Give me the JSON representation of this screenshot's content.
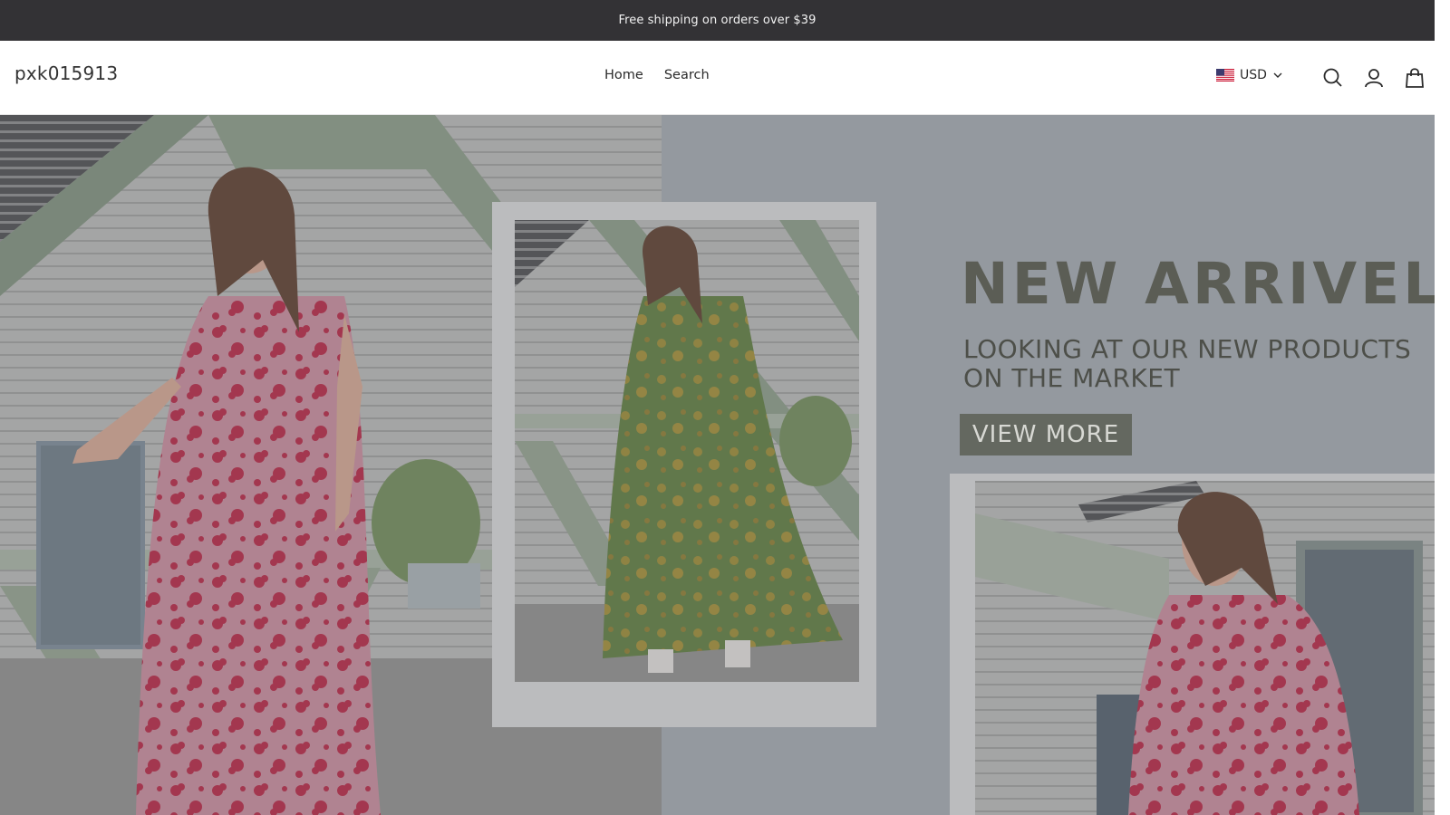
{
  "announcement": {
    "text": "Free shipping on orders over $39"
  },
  "header": {
    "logo": "pxk015913",
    "nav": [
      {
        "label": "Home"
      },
      {
        "label": "Search"
      }
    ],
    "currency": {
      "label": "USD",
      "flag": "us-flag-icon"
    },
    "icons": [
      "search-icon",
      "account-icon",
      "cart-icon"
    ]
  },
  "hero": {
    "title": "NEW ARRIVEL",
    "subtitle_line1": "LOOKING AT OUR NEW PRODUCTS",
    "subtitle_line2": "ON THE MARKET",
    "button": "VIEW MORE"
  },
  "colors": {
    "announcement_bg": "#333235",
    "dress_pink": "#c98a9a",
    "dress_red_print": "#b8213f",
    "dress_green": "#5c7a3a",
    "button_bg": "#646860"
  }
}
